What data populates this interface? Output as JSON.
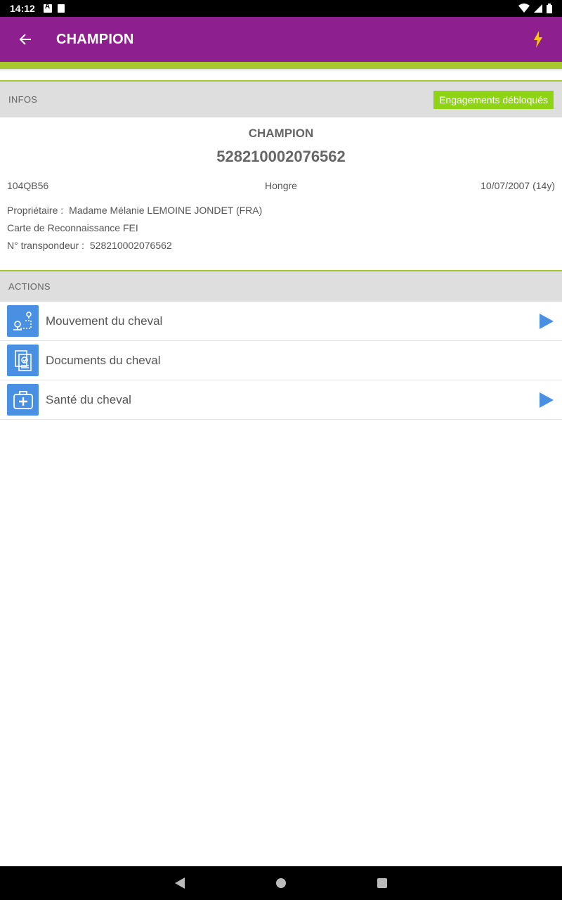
{
  "status_bar": {
    "time": "14:12"
  },
  "app_bar": {
    "title": "CHAMPION"
  },
  "infos": {
    "header": "INFOS",
    "badge": "Engagements débloqués",
    "name": "CHAMPION",
    "id": "528210002076562",
    "code": "104QB56",
    "sex": "Hongre",
    "birth": "10/07/2007 (14y)",
    "owner_label": "Propriétaire :",
    "owner_value": "Madame Mélanie LEMOINE JONDET (FRA)",
    "card": "Carte de Reconnaissance FEI",
    "transponder_label": "N° transpondeur :",
    "transponder_value": "528210002076562"
  },
  "actions": {
    "header": "ACTIONS",
    "items": [
      {
        "label": "Mouvement du cheval",
        "icon": "map-route-icon"
      },
      {
        "label": "Documents du cheval",
        "icon": "documents-icon"
      },
      {
        "label": "Santé du cheval",
        "icon": "medical-kit-icon"
      }
    ]
  },
  "colors": {
    "primary": "#8e1f8e",
    "accent": "#a6c72d",
    "badge": "#8fd414",
    "action_icon": "#4a90e2"
  }
}
